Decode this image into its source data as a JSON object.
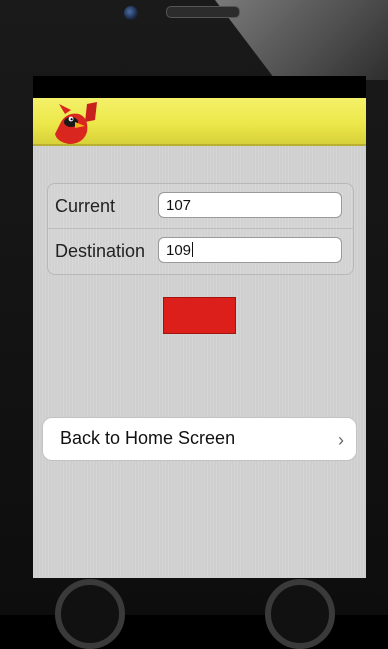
{
  "form": {
    "current_label": "Current",
    "current_value": "107",
    "destination_label": "Destination",
    "destination_value": "109"
  },
  "nav": {
    "back_label": "Back to Home Screen",
    "chevron": "›"
  },
  "colors": {
    "header_yellow": "#ece84a",
    "red_button": "#dc1f1a",
    "screen_bg": "#cfcfcf"
  },
  "icons": {
    "mascot": "cardinal-mascot-icon",
    "chevron": "chevron-right-icon"
  }
}
